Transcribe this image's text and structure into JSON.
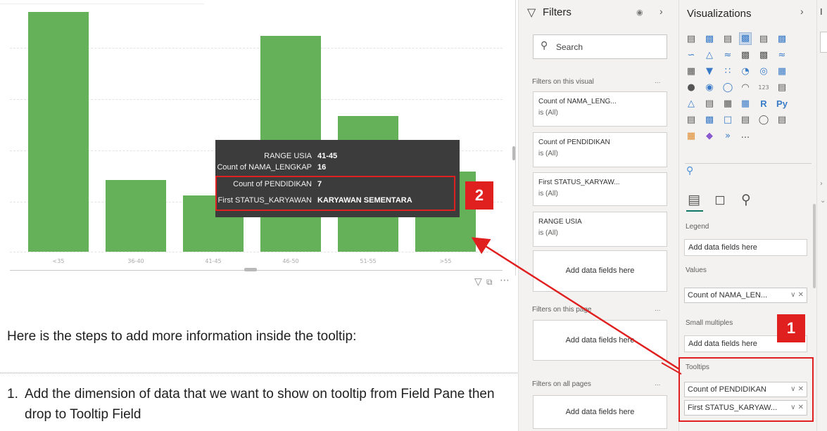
{
  "chart_data": {
    "type": "bar",
    "categories": [
      "<35",
      "36-40",
      "41-45",
      "46-50",
      "51-55",
      ">55"
    ],
    "values": [
      33,
      9,
      7,
      27,
      17,
      10
    ],
    "ylim": [
      0,
      30
    ],
    "title": "",
    "xlabel": "",
    "ylabel": "",
    "color": "#64b15a",
    "grid": true
  },
  "tooltip": {
    "rows": [
      {
        "key": "RANGE USIA",
        "value": "41-45"
      },
      {
        "key": "Count of NAMA_LENGKAP",
        "value": "16"
      },
      {
        "key": "Count of PENDIDIKAN",
        "value": "7"
      },
      {
        "key": "First STATUS_KARYAWAN",
        "value": "KARYAWAN SEMENTARA"
      }
    ]
  },
  "visual_header_icons": [
    "filter-icon",
    "focus-mode-icon",
    "more-options-icon"
  ],
  "callouts": {
    "one": "1",
    "two": "2"
  },
  "instructions": {
    "intro": "Here is the steps to add more information inside the tooltip:",
    "step_number": "1.",
    "step_text": "Add the dimension of data that we want to show on tooltip from Field Pane then drop to Tooltip Field"
  },
  "filters_pane": {
    "title": "Filters",
    "search_placeholder": "Search",
    "on_visual_label": "Filters on this visual",
    "cards": [
      {
        "name": "Count of NAMA_LENG...",
        "state": "is (All)"
      },
      {
        "name": "Count of PENDIDIKAN",
        "state": "is (All)"
      },
      {
        "name": "First STATUS_KARYAW...",
        "state": "is (All)"
      },
      {
        "name": "RANGE USIA",
        "state": "is (All)"
      }
    ],
    "add_fields_label": "Add data fields here",
    "on_page_label": "Filters on this page",
    "on_all_pages_label": "Filters on all pages",
    "more_label": "..."
  },
  "viz_pane": {
    "title": "Visualizations",
    "legend_label": "Legend",
    "legend_placeholder": "Add data fields here",
    "values_label": "Values",
    "values_field": "Count of NAMA_LEN...",
    "small_multiples_label": "Small multiples",
    "small_multiples_placeholder": "Add data fields here",
    "tooltips_label": "Tooltips",
    "tooltip_fields": [
      "Count of PENDIDIKAN",
      "First STATUS_KARYAW..."
    ],
    "r_label": "R",
    "py_label": "Py",
    "more_visuals": "..."
  },
  "fields_pane": {
    "letter": "I"
  },
  "colors": {
    "accent_red": "#e01f1f",
    "bar_green": "#64b15a",
    "pane_bg": "#f3f2f1"
  }
}
